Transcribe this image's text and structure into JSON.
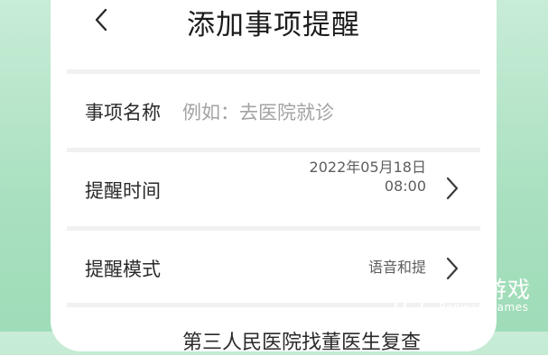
{
  "header": {
    "title": "添加事项提醒"
  },
  "rows": [
    {
      "label": "事项名称",
      "placeholder": "例如：去医院就诊"
    },
    {
      "label": "提醒时间",
      "value_line1": "2022年05月18日",
      "value_line2": "08:00"
    },
    {
      "label": "提醒模式",
      "value": "语音和提"
    }
  ],
  "bottom_partial_text": "第三人民医院找董医生复查",
  "watermark": {
    "name": "仍玩游戏",
    "sub": "Renwan Games"
  },
  "colors": {
    "background": "#a9e0c0",
    "card": "#ffffff",
    "divider": "#f1f1f1"
  }
}
